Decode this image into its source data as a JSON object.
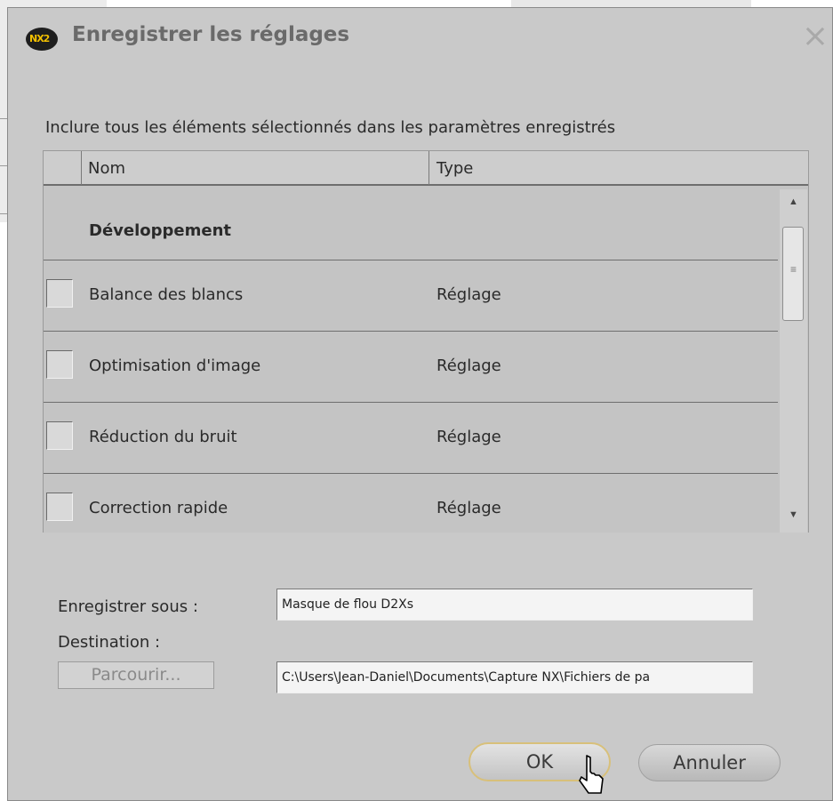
{
  "dialog": {
    "title": "Enregistrer les réglages",
    "app_icon_text": "NX2",
    "close_glyph": "×",
    "instruction": "Inclure tous les éléments sélectionnés dans les paramètres enregistrés"
  },
  "list": {
    "columns": [
      "Nom",
      "Type"
    ],
    "group_label": "Développement",
    "rows": [
      {
        "name": "Balance des blancs",
        "type": "Réglage",
        "checked": false
      },
      {
        "name": "Optimisation d'image",
        "type": "Réglage",
        "checked": false
      },
      {
        "name": "Réduction du bruit",
        "type": "Réglage",
        "checked": false
      },
      {
        "name": "Correction rapide",
        "type": "Réglage",
        "checked": false
      }
    ]
  },
  "form": {
    "save_as_label": "Enregistrer sous :",
    "save_as_value": "Masque de flou D2Xs",
    "destination_label": "Destination :",
    "browse_label": "Parcourir...",
    "destination_value": "C:\\Users\\Jean-Daniel\\Documents\\Capture NX\\Fichiers de pa"
  },
  "buttons": {
    "ok": "OK",
    "cancel": "Annuler"
  },
  "icons": {
    "app": "nx2-logo-icon",
    "close": "close-icon",
    "scroll_up": "scroll-up-arrow-icon",
    "scroll_down": "scroll-down-arrow-icon",
    "cursor": "mouse-cursor-icon"
  }
}
